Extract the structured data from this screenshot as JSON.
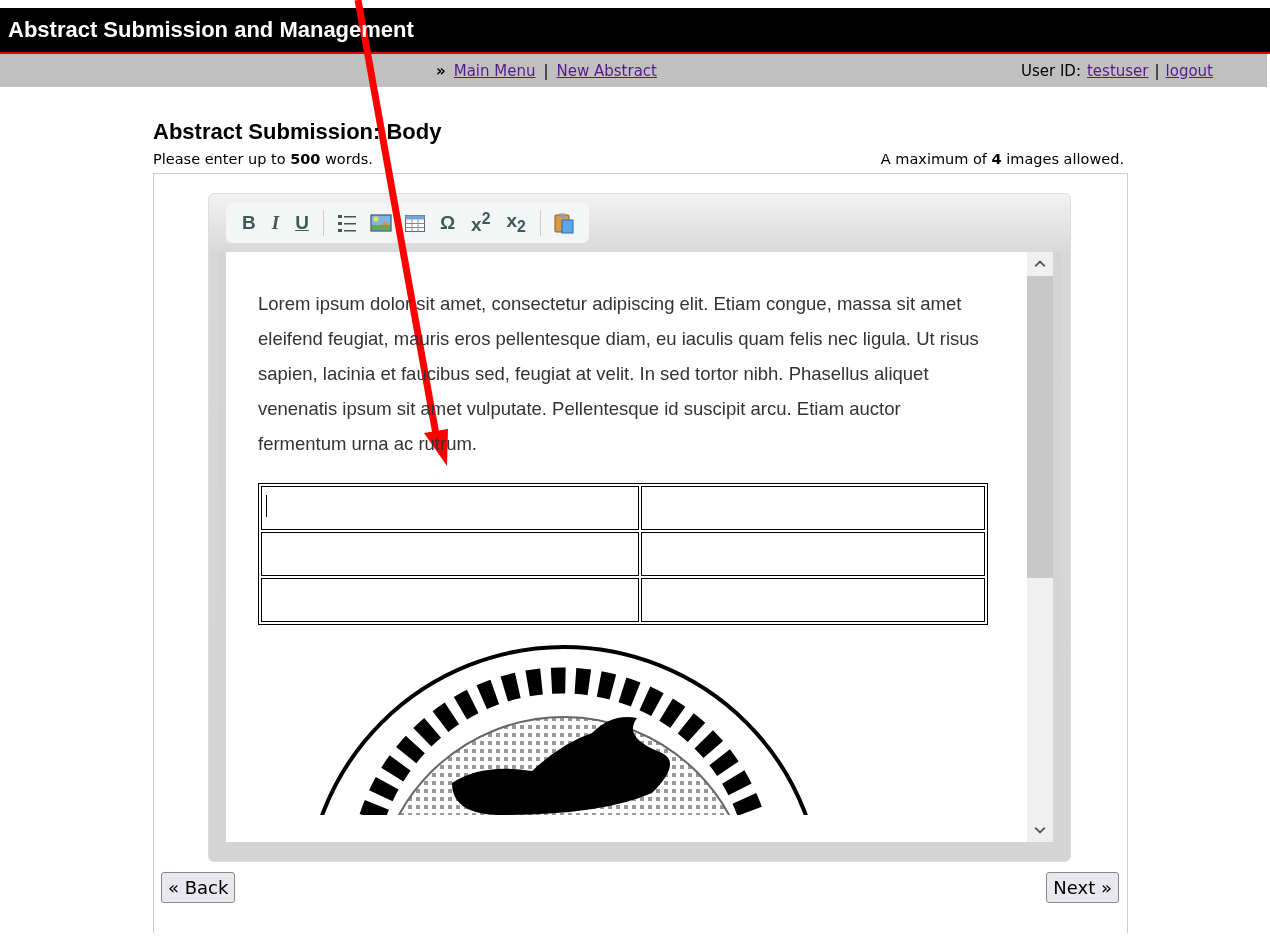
{
  "header": {
    "title": "Abstract Submission and Management"
  },
  "nav": {
    "marker": "»",
    "links": [
      {
        "label": "Main Menu"
      },
      {
        "label": "New Abstract"
      }
    ],
    "separator": "|",
    "user_label": "User ID:",
    "user": "testuser",
    "user_separator": "|",
    "logout": "logout"
  },
  "page": {
    "heading": "Abstract Submission: Body",
    "word_limit": "Please enter up to **500** words.",
    "image_limit": "A maximum of **4** images allowed."
  },
  "editor": {
    "toolbar": [
      {
        "kind": "bold",
        "label": "B"
      },
      {
        "kind": "italic",
        "label": "I"
      },
      {
        "kind": "underline",
        "label": "U"
      },
      {
        "kind": "separator"
      },
      {
        "kind": "list"
      },
      {
        "kind": "image"
      },
      {
        "kind": "table"
      },
      {
        "kind": "char",
        "label": "Ω"
      },
      {
        "kind": "char",
        "label": "x$^{2}$"
      },
      {
        "kind": "char",
        "label": "x$_{2}$"
      },
      {
        "kind": "separator"
      },
      {
        "kind": "paste"
      }
    ],
    "paragraph": "Lorem ipsum dolor sit amet, consectetur adipiscing elit. Etiam congue, massa sit amet eleifend feugiat, mauris eros pellentesque diam, eu iaculis quam felis nec ligula. Ut risus sapien, lacinia et faucibus sed, feugiat at velit. In sed tortor nibh. Phasellus aliquet venenatis ipsum sit amet vulputate. Pellentesque id suscipit arcu. Etiam auctor fermentum urna ac rutrum.",
    "table": {
      "rows": [
        {
          "cells": [
            {
              "cursor": true
            },
            {
              "cursor": false
            }
          ]
        },
        {
          "cells": [
            {
              "cursor": false
            },
            {
              "cursor": false
            }
          ]
        },
        {
          "cells": [
            {
              "cursor": false
            },
            {
              "cursor": false
            }
          ]
        }
      ]
    }
  },
  "buttons": {
    "back": "« Back",
    "next": "Next »"
  },
  "annotation": {
    "kind": "arrow"
  }
}
